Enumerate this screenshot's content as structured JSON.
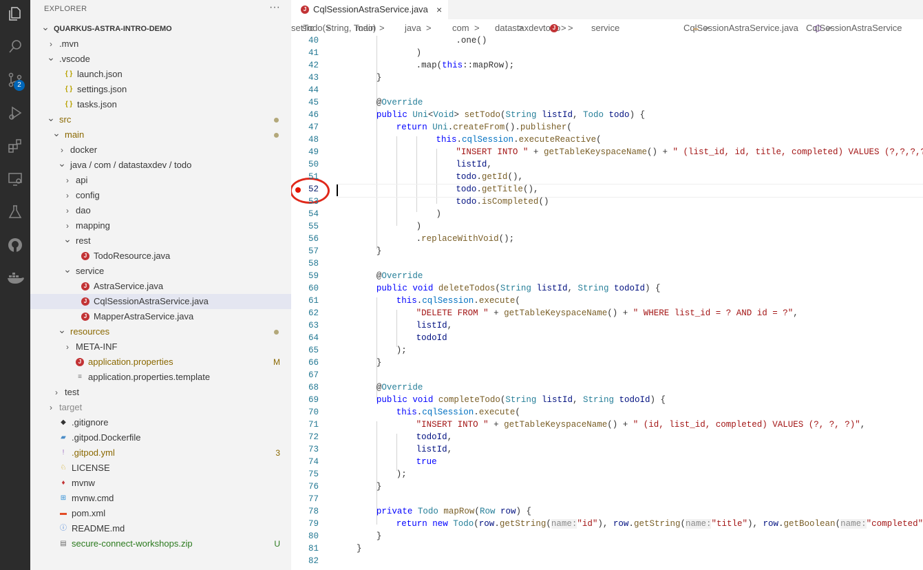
{
  "activity_bar": {
    "icons": [
      "explorer-icon",
      "search-icon",
      "source-control-icon",
      "run-debug-icon",
      "extensions-icon",
      "remote-explorer-icon",
      "testing-icon",
      "github-icon",
      "docker-icon"
    ],
    "source_control_badge": "2"
  },
  "sidebar": {
    "title": "EXPLORER",
    "more": "···",
    "tree": [
      {
        "label": "QUARKUS-ASTRA-INTRO-DEMO",
        "depth": 0,
        "chevron": "down",
        "icon": "",
        "bold": true
      },
      {
        "label": ".mvn",
        "depth": 1,
        "chevron": "right",
        "icon": ""
      },
      {
        "label": ".vscode",
        "depth": 1,
        "chevron": "down",
        "icon": ""
      },
      {
        "label": "launch.json",
        "depth": 2,
        "icon": "json"
      },
      {
        "label": "settings.json",
        "depth": 2,
        "icon": "json"
      },
      {
        "label": "tasks.json",
        "depth": 2,
        "icon": "json"
      },
      {
        "label": "src",
        "depth": 1,
        "chevron": "down",
        "icon": "",
        "status": "mod",
        "dot": true
      },
      {
        "label": "main",
        "depth": 2,
        "chevron": "down",
        "icon": "",
        "status": "mod",
        "dot": true
      },
      {
        "label": "docker",
        "depth": 3,
        "chevron": "right",
        "icon": ""
      },
      {
        "label": "java / com / datastaxdev / todo",
        "depth": 3,
        "chevron": "down",
        "icon": ""
      },
      {
        "label": "api",
        "depth": 4,
        "chevron": "right",
        "icon": ""
      },
      {
        "label": "config",
        "depth": 4,
        "chevron": "right",
        "icon": ""
      },
      {
        "label": "dao",
        "depth": 4,
        "chevron": "right",
        "icon": ""
      },
      {
        "label": "mapping",
        "depth": 4,
        "chevron": "right",
        "icon": ""
      },
      {
        "label": "rest",
        "depth": 4,
        "chevron": "down",
        "icon": ""
      },
      {
        "label": "TodoResource.java",
        "depth": 5,
        "icon": "java"
      },
      {
        "label": "service",
        "depth": 4,
        "chevron": "down",
        "icon": ""
      },
      {
        "label": "AstraService.java",
        "depth": 5,
        "icon": "java"
      },
      {
        "label": "CqlSessionAstraService.java",
        "depth": 5,
        "icon": "java",
        "selected": true
      },
      {
        "label": "MapperAstraService.java",
        "depth": 5,
        "icon": "java"
      },
      {
        "label": "resources",
        "depth": 3,
        "chevron": "down",
        "icon": "",
        "status": "mod",
        "dot": true
      },
      {
        "label": "META-INF",
        "depth": 4,
        "chevron": "right",
        "icon": ""
      },
      {
        "label": "application.properties",
        "depth": 4,
        "icon": "java",
        "status": "mod",
        "badge": "M"
      },
      {
        "label": "application.properties.template",
        "depth": 4,
        "icon": "lines"
      },
      {
        "label": "test",
        "depth": 2,
        "chevron": "right",
        "icon": ""
      },
      {
        "label": "target",
        "depth": 1,
        "chevron": "right",
        "icon": "",
        "dim": true
      },
      {
        "label": ".gitignore",
        "depth": 1,
        "icon": "git"
      },
      {
        "label": ".gitpod.Dockerfile",
        "depth": 1,
        "icon": "docker"
      },
      {
        "label": ".gitpod.yml",
        "depth": 1,
        "icon": "yml",
        "status": "mod",
        "badge": "3"
      },
      {
        "label": "LICENSE",
        "depth": 1,
        "icon": "license"
      },
      {
        "label": "mvnw",
        "depth": 1,
        "icon": "pin"
      },
      {
        "label": "mvnw.cmd",
        "depth": 1,
        "icon": "win"
      },
      {
        "label": "pom.xml",
        "depth": 1,
        "icon": "xml"
      },
      {
        "label": "README.md",
        "depth": 1,
        "icon": "info"
      },
      {
        "label": "secure-connect-workshops.zip",
        "depth": 1,
        "icon": "zip",
        "status": "unt",
        "badge": "U"
      }
    ]
  },
  "tab": {
    "label": "CqlSessionAstraService.java",
    "close": "×"
  },
  "breadcrumbs": [
    "src",
    ">",
    "main",
    ">",
    "java",
    ">",
    "com",
    ">",
    "datastaxdev",
    ">",
    "todo",
    ">",
    "service",
    ">",
    "CqlSessionAstraService.java",
    ">",
    "CqlSessionAstraService",
    ">",
    "setTodo(String, Todo)"
  ],
  "editor": {
    "current_line": "52",
    "breakpoint_line": "52",
    "lines": [
      {
        "n": "40",
        "t": [
          [
            "",
            ".one()"
          ]
        ],
        "indent": 20
      },
      {
        "n": "41",
        "t": [
          [
            "",
            ")"
          ]
        ],
        "indent": 12
      },
      {
        "n": "42",
        "t": [
          [
            "",
            ".map("
          ],
          [
            "k",
            "this"
          ],
          [
            "",
            "::mapRow);"
          ]
        ],
        "indent": 12
      },
      {
        "n": "43",
        "t": [
          [
            "",
            "}"
          ]
        ],
        "indent": 4
      },
      {
        "n": "44",
        "t": [],
        "indent": 0
      },
      {
        "n": "45",
        "t": [
          [
            "",
            "@"
          ],
          [
            "t",
            "Override"
          ]
        ],
        "indent": 4
      },
      {
        "n": "46",
        "t": [
          [
            "k",
            "public "
          ],
          [
            "t",
            "Uni"
          ],
          [
            "",
            "<"
          ],
          [
            "t",
            "Void"
          ],
          [
            "",
            "> "
          ],
          [
            "f",
            "setTodo"
          ],
          [
            "",
            "("
          ],
          [
            "t",
            "String "
          ],
          [
            "v",
            "listId"
          ],
          [
            "",
            " , "
          ],
          [
            "t",
            "Todo "
          ],
          [
            "v",
            "todo"
          ],
          [
            "",
            ") {"
          ]
        ],
        "indent": 4
      },
      {
        "n": "47",
        "t": [
          [
            "k",
            "return "
          ],
          [
            "t",
            "Uni"
          ],
          [
            "",
            "."
          ],
          [
            "f",
            "createFrom"
          ],
          [
            "",
            "()."
          ],
          [
            "f",
            "publisher"
          ],
          [
            "",
            "("
          ]
        ],
        "indent": 8
      },
      {
        "n": "48",
        "t": [
          [
            "k",
            "this"
          ],
          [
            "",
            "."
          ],
          [
            "fld",
            "cqlSession"
          ],
          [
            "",
            "."
          ],
          [
            "f",
            "executeReactive"
          ],
          [
            "",
            "("
          ]
        ],
        "indent": 16
      },
      {
        "n": "49",
        "t": [
          [
            "s",
            "\"INSERT INTO \""
          ],
          [
            "",
            " + "
          ],
          [
            "f",
            "getTableKeyspaceName"
          ],
          [
            "",
            "() + "
          ],
          [
            "s",
            "\" (list_id, id, title, completed) VALUES (?,?,?,?)\""
          ],
          [
            "",
            ","
          ]
        ],
        "indent": 20
      },
      {
        "n": "50",
        "t": [
          [
            "v",
            "listId"
          ],
          [
            "",
            ","
          ]
        ],
        "indent": 20
      },
      {
        "n": "51",
        "t": [
          [
            "v",
            "todo"
          ],
          [
            "",
            "."
          ],
          [
            "f",
            "getId"
          ],
          [
            "",
            "(),"
          ]
        ],
        "indent": 20
      },
      {
        "n": "52",
        "t": [
          [
            "v",
            "todo"
          ],
          [
            "",
            "."
          ],
          [
            "f",
            "getTitle"
          ],
          [
            "",
            "(),"
          ]
        ],
        "indent": 20
      },
      {
        "n": "53",
        "t": [
          [
            "v",
            "todo"
          ],
          [
            "",
            "."
          ],
          [
            "f",
            "isCompleted"
          ],
          [
            "",
            "()"
          ]
        ],
        "indent": 20
      },
      {
        "n": "54",
        "t": [
          [
            "",
            ")"
          ]
        ],
        "indent": 16
      },
      {
        "n": "55",
        "t": [
          [
            "",
            ")"
          ]
        ],
        "indent": 12
      },
      {
        "n": "56",
        "t": [
          [
            "",
            "."
          ],
          [
            "f",
            "replaceWithVoid"
          ],
          [
            "",
            "();"
          ]
        ],
        "indent": 12
      },
      {
        "n": "57",
        "t": [
          [
            "",
            "}"
          ]
        ],
        "indent": 4
      },
      {
        "n": "58",
        "t": [],
        "indent": 0
      },
      {
        "n": "59",
        "t": [
          [
            "",
            "@"
          ],
          [
            "t",
            "Override"
          ]
        ],
        "indent": 4
      },
      {
        "n": "60",
        "t": [
          [
            "k",
            "public void "
          ],
          [
            "f",
            "deleteTodos"
          ],
          [
            "",
            "("
          ],
          [
            "t",
            "String "
          ],
          [
            "v",
            "listId"
          ],
          [
            "",
            ", "
          ],
          [
            "t",
            "String "
          ],
          [
            "v",
            "todoId"
          ],
          [
            "",
            ") {"
          ]
        ],
        "indent": 4
      },
      {
        "n": "61",
        "t": [
          [
            "k",
            "this"
          ],
          [
            "",
            "."
          ],
          [
            "fld",
            "cqlSession"
          ],
          [
            "",
            "."
          ],
          [
            "f",
            "execute"
          ],
          [
            "",
            "("
          ]
        ],
        "indent": 8
      },
      {
        "n": "62",
        "t": [
          [
            "s",
            "\"DELETE FROM \""
          ],
          [
            "",
            " + "
          ],
          [
            "f",
            "getTableKeyspaceName"
          ],
          [
            "",
            "() + "
          ],
          [
            "s",
            "\" WHERE list_id = ? AND id = ?\""
          ],
          [
            "",
            ","
          ]
        ],
        "indent": 12
      },
      {
        "n": "63",
        "t": [
          [
            "v",
            "listId"
          ],
          [
            "",
            ","
          ]
        ],
        "indent": 12
      },
      {
        "n": "64",
        "t": [
          [
            "v",
            "todoId"
          ]
        ],
        "indent": 12
      },
      {
        "n": "65",
        "t": [
          [
            "",
            ");"
          ]
        ],
        "indent": 8
      },
      {
        "n": "66",
        "t": [
          [
            "",
            "}"
          ]
        ],
        "indent": 4
      },
      {
        "n": "67",
        "t": [],
        "indent": 0
      },
      {
        "n": "68",
        "t": [
          [
            "",
            "@"
          ],
          [
            "t",
            "Override"
          ]
        ],
        "indent": 4
      },
      {
        "n": "69",
        "t": [
          [
            "k",
            "public void "
          ],
          [
            "f",
            "completeTodo"
          ],
          [
            "",
            "("
          ],
          [
            "t",
            "String "
          ],
          [
            "v",
            "listId"
          ],
          [
            "",
            ", "
          ],
          [
            "t",
            "String "
          ],
          [
            "v",
            "todoId"
          ],
          [
            "",
            ") {"
          ]
        ],
        "indent": 4
      },
      {
        "n": "70",
        "t": [
          [
            "k",
            "this"
          ],
          [
            "",
            "."
          ],
          [
            "fld",
            "cqlSession"
          ],
          [
            "",
            "."
          ],
          [
            "f",
            "execute"
          ],
          [
            "",
            "("
          ]
        ],
        "indent": 8
      },
      {
        "n": "71",
        "t": [
          [
            "s",
            "\"INSERT INTO \""
          ],
          [
            "",
            " + "
          ],
          [
            "f",
            "getTableKeyspaceName"
          ],
          [
            "",
            "() + "
          ],
          [
            "s",
            "\" (id, list_id, completed) VALUES (?, ?, ?)\""
          ],
          [
            "",
            ","
          ]
        ],
        "indent": 12
      },
      {
        "n": "72",
        "t": [
          [
            "v",
            "todoId"
          ],
          [
            "",
            ","
          ]
        ],
        "indent": 12
      },
      {
        "n": "73",
        "t": [
          [
            "v",
            "listId"
          ],
          [
            "",
            ","
          ]
        ],
        "indent": 12
      },
      {
        "n": "74",
        "t": [
          [
            "k",
            "true"
          ]
        ],
        "indent": 12
      },
      {
        "n": "75",
        "t": [
          [
            "",
            ");"
          ]
        ],
        "indent": 8
      },
      {
        "n": "76",
        "t": [
          [
            "",
            "}"
          ]
        ],
        "indent": 4
      },
      {
        "n": "77",
        "t": [],
        "indent": 0
      },
      {
        "n": "78",
        "t": [
          [
            "k",
            "private "
          ],
          [
            "t",
            "Todo "
          ],
          [
            "f",
            "mapRow"
          ],
          [
            "",
            "("
          ],
          [
            "t",
            "Row "
          ],
          [
            "v",
            "row"
          ],
          [
            "",
            ") {"
          ]
        ],
        "indent": 4
      },
      {
        "n": "79",
        "t": [
          [
            "k",
            "return new "
          ],
          [
            "t",
            "Todo"
          ],
          [
            "",
            "("
          ],
          [
            "v",
            "row"
          ],
          [
            "",
            "."
          ],
          [
            "f",
            "getString"
          ],
          [
            "",
            "("
          ],
          [
            "hint",
            "name:"
          ],
          [
            "s",
            "\"id\""
          ],
          [
            "",
            "), "
          ],
          [
            "v",
            "row"
          ],
          [
            "",
            "."
          ],
          [
            "f",
            "getString"
          ],
          [
            "",
            "("
          ],
          [
            "hint",
            "name:"
          ],
          [
            "s",
            "\"title\""
          ],
          [
            "",
            "), "
          ],
          [
            "v",
            "row"
          ],
          [
            "",
            "."
          ],
          [
            "f",
            "getBoolean"
          ],
          [
            "",
            "("
          ],
          [
            "hint",
            "name:"
          ],
          [
            "s",
            "\"completed\""
          ],
          [
            "",
            "));"
          ]
        ],
        "indent": 8
      },
      {
        "n": "80",
        "t": [
          [
            "",
            "}"
          ]
        ],
        "indent": 4
      },
      {
        "n": "81",
        "t": [
          [
            "",
            "}"
          ]
        ],
        "indent": 0
      },
      {
        "n": "82",
        "t": [],
        "indent": 0
      }
    ]
  }
}
